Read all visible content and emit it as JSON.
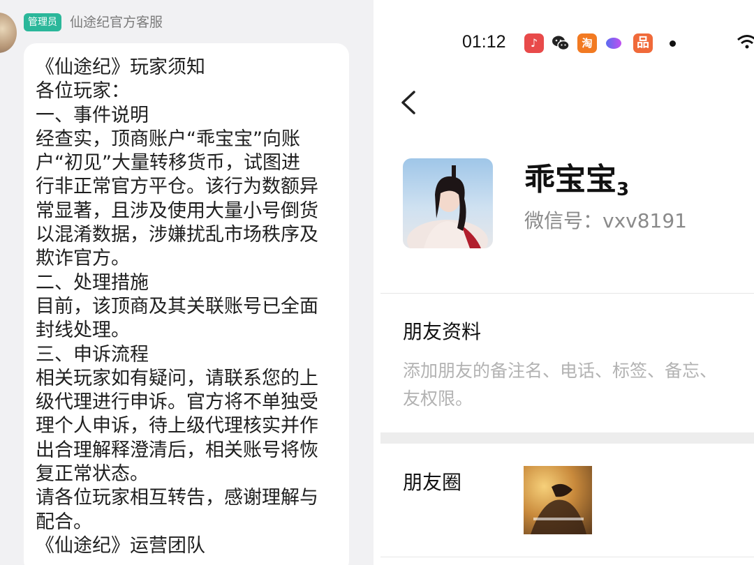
{
  "left_chat": {
    "admin_badge": "管理员",
    "sender_name": "仙途纪官方客服",
    "message_lines": [
      "《仙途纪》玩家须知",
      "各位玩家：",
      "一、事件说明",
      "经查实，顶商账户“乖宝宝”向账",
      "户“初见”大量转移货币，试图进",
      "行非正常官方平仓。该行为数额异",
      "常显著，且涉及使用大量小号倒货",
      "以混淆数据，涉嫌扰乱市场秩序及",
      "欺诈官方。",
      "二、处理措施",
      "目前，该顶商及其关联账号已全面",
      "封线处理。",
      "三、申诉流程",
      "相关玩家如有疑问，请联系您的上",
      "级代理进行申诉。官方将不单独受",
      "理个人申诉，待上级代理核实并作",
      "出合理解释澄清后，相关账号将恢",
      "复正常状态。",
      "请各位玩家相互转告，感谢理解与",
      "配合。",
      "《仙途纪》运营团队"
    ]
  },
  "right_profile": {
    "status_bar": {
      "time": "01:12",
      "icons": [
        "music-app-icon",
        "wechat-icon",
        "taobao-icon",
        "chat-app-icon",
        "pinduoduo-icon",
        "notification-dot",
        "wifi-icon"
      ],
      "taobao_label": "淘",
      "pdd_label": "品"
    },
    "nickname": "乖宝宝",
    "nickname_suffix": "3",
    "wechat_id": "微信号：vxv8191",
    "friend_info": {
      "title": "朋友资料",
      "desc_line1": "添加朋友的备注名、电话、标签、备忘、",
      "desc_line2": "友权限。"
    },
    "moments": {
      "title": "朋友圈"
    }
  },
  "colors": {
    "admin_badge": "#2bb79a",
    "chat_background": "#f1f1f3",
    "secondary_text": "#8a8a8a",
    "hint_text": "#b2b2b2"
  }
}
